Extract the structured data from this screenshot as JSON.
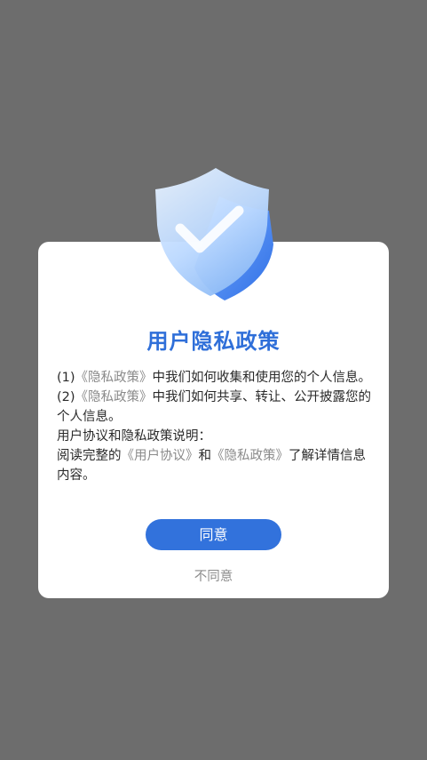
{
  "dialog": {
    "title": "用户隐私政策",
    "item1": {
      "prefix": "(1)",
      "link": "《隐私政策》",
      "text": "中我们如何收集和使用您的个人信息。"
    },
    "item2": {
      "prefix": "(2)",
      "link": "《隐私政策》",
      "text": "中我们如何共享、转让、公开披露您的个人信息。"
    },
    "subheading": "用户协议和隐私政策说明：",
    "read": {
      "prefix": "阅读完整的",
      "link1": "《用户协议》",
      "and": "和",
      "link2": "《隐私政策》",
      "suffix": "了解详情信息内容。"
    },
    "agree_label": "同意",
    "disagree_label": "不同意"
  },
  "colors": {
    "accent": "#3272dc",
    "title": "#2f6fd9",
    "link": "#8a8a8a",
    "backdrop": "#6d6d6d"
  },
  "icons": {
    "header": "shield-check-icon"
  }
}
